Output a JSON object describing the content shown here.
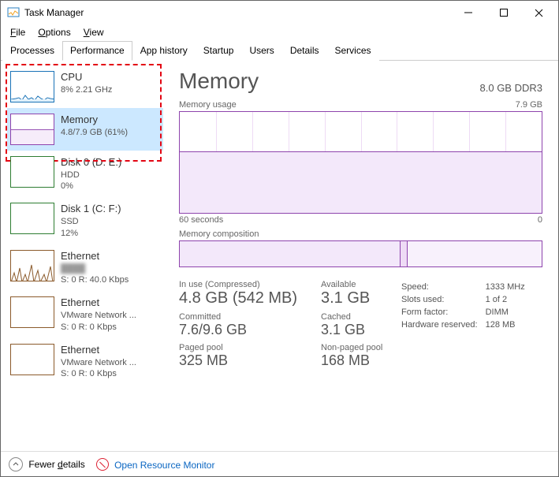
{
  "window": {
    "title": "Task Manager"
  },
  "menu": {
    "file": "File",
    "options": "Options",
    "view": "View"
  },
  "tabs": [
    {
      "label": "Processes"
    },
    {
      "label": "Performance",
      "active": true
    },
    {
      "label": "App history"
    },
    {
      "label": "Startup"
    },
    {
      "label": "Users"
    },
    {
      "label": "Details"
    },
    {
      "label": "Services"
    }
  ],
  "sidebar": [
    {
      "name": "CPU",
      "sub": "8% 2.21 GHz",
      "thumb": "cpu"
    },
    {
      "name": "Memory",
      "sub": "4.8/7.9 GB (61%)",
      "thumb": "mem",
      "selected": true
    },
    {
      "name": "Disk 0 (D: E:)",
      "sub": "HDD",
      "sub2": "0%",
      "thumb": "disk"
    },
    {
      "name": "Disk 1 (C: F:)",
      "sub": "SSD",
      "sub2": "12%",
      "thumb": "disk"
    },
    {
      "name": "Ethernet",
      "sub": "",
      "sub2": "S: 0 R: 40.0 Kbps",
      "thumb": "eth",
      "subBlur": true
    },
    {
      "name": "Ethernet",
      "sub": "VMware Network ...",
      "sub2": "S: 0 R: 0 Kbps",
      "thumb": "eth"
    },
    {
      "name": "Ethernet",
      "sub": "VMware Network ...",
      "sub2": "S: 0 R: 0 Kbps",
      "thumb": "eth"
    }
  ],
  "detail": {
    "title": "Memory",
    "header_right": "8.0 GB DDR3",
    "chart": {
      "label": "Memory usage",
      "max": "7.9 GB",
      "x_left": "60 seconds",
      "x_right": "0"
    },
    "composition_label": "Memory composition",
    "metrics": {
      "in_use_label": "In use (Compressed)",
      "in_use": "4.8 GB (542 MB)",
      "available_label": "Available",
      "available": "3.1 GB",
      "committed_label": "Committed",
      "committed": "7.6/9.6 GB",
      "cached_label": "Cached",
      "cached": "3.1 GB",
      "paged_label": "Paged pool",
      "paged": "325 MB",
      "nonpaged_label": "Non-paged pool",
      "nonpaged": "168 MB"
    },
    "kv": {
      "speed_label": "Speed:",
      "speed": "1333 MHz",
      "slots_label": "Slots used:",
      "slots": "1 of 2",
      "form_label": "Form factor:",
      "form": "DIMM",
      "reserved_label": "Hardware reserved:",
      "reserved": "128 MB"
    }
  },
  "footer": {
    "details": "Fewer details",
    "link": "Open Resource Monitor"
  },
  "chart_data": {
    "type": "area",
    "title": "Memory usage",
    "ylabel": "GB",
    "ylim": [
      0,
      7.9
    ],
    "x": [
      60,
      0
    ],
    "series": [
      {
        "name": "Memory",
        "values": [
          4.8,
          4.8
        ]
      }
    ],
    "composition_segments_pct": [
      61,
      2,
      37
    ]
  }
}
